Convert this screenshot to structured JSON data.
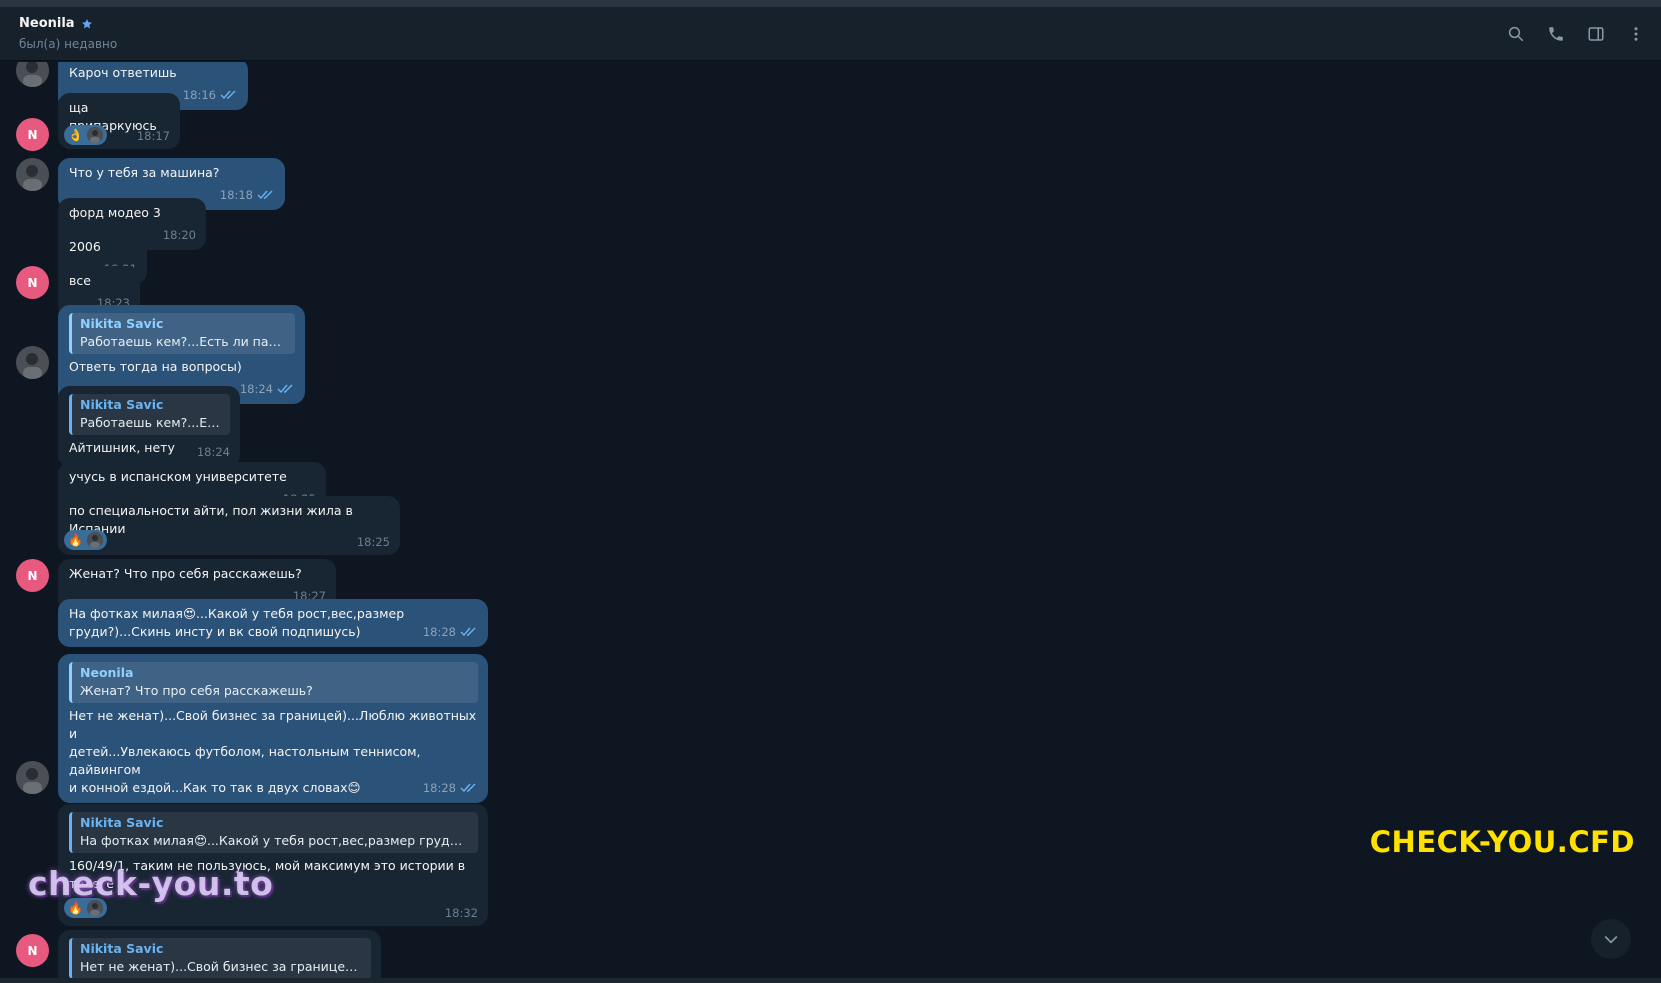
{
  "header": {
    "name": "Neonila",
    "status": "был(а) недавно",
    "icons": [
      "star-icon",
      "search-icon",
      "phone-icon",
      "sidebar-toggle-icon",
      "more-vertical-icon"
    ]
  },
  "avatar_initial": "N",
  "messages": [
    {
      "id": "m1",
      "text": "Кароч ответишь",
      "time": "18:16"
    },
    {
      "id": "m2",
      "text": "ща припаркуюсь",
      "time": "18:17",
      "reaction": "👌"
    },
    {
      "id": "m3",
      "text": "Что у тебя за машина?",
      "time": "18:18"
    },
    {
      "id": "m4",
      "text": "форд модео 3",
      "time": "18:20"
    },
    {
      "id": "m5",
      "text": "2006",
      "time": "18:21"
    },
    {
      "id": "m6",
      "text": "все",
      "time": "18:23"
    },
    {
      "id": "m7",
      "reply_name": "Nikita Savic",
      "reply_text": "Работаешь кем?...Есть ли парен...",
      "text": "Ответь тогда на вопросы)",
      "time": "18:24"
    },
    {
      "id": "m8",
      "reply_name": "Nikita Savic",
      "reply_text": "Работаешь кем?...Ест...",
      "text": "Айтишник, нету",
      "time": "18:24"
    },
    {
      "id": "m9",
      "text": "учусь в испанском университете",
      "time": "18:25"
    },
    {
      "id": "m10",
      "text": "по специальности айти, пол жизни жила в Испании",
      "time": "18:25",
      "reaction": "🔥"
    },
    {
      "id": "m11",
      "text": "Женат? Что про себя расскажешь?",
      "time": "18:27"
    },
    {
      "id": "m12",
      "text_line1": "На фотках милая😍...Какой у тебя рост,вес,размер",
      "text_line2": "груди?)...Скинь инсту и вк свой подпишусь)",
      "time": "18:28"
    },
    {
      "id": "m13",
      "reply_name": "Neonila",
      "reply_text": "Женат? Что про себя расскажешь?",
      "text_line1": "Нет не женат)...Свой бизнес за границей)...Люблю животных и",
      "text_line2": "детей...Увлекаюсь футболом, настольным теннисом, дайвингом",
      "text_line3": "и конной ездой...Как то так в двух словах😊",
      "time": "18:28"
    },
    {
      "id": "m14",
      "reply_name": "Nikita Savic",
      "reply_text": "На фотках милая😍...Какой у тебя рост,вес,размер груди?)......",
      "text_line1": "160/49/1, таким не пользуюсь, мой максимум это истории в",
      "text_line2": "телеге",
      "time": "18:32",
      "reaction": "🔥"
    },
    {
      "id": "m15",
      "reply_name": "Nikita Savic",
      "reply_text": "Нет не женат)...Свой бизнес за границей)...Л..."
    }
  ],
  "watermarks": {
    "right": "CHECK-YOU.CFD",
    "left": "check-you.to"
  },
  "colors": {
    "background": "#0e1621",
    "header": "#17212b",
    "outgoing_bubble": "#2b5278",
    "incoming_bubble": "#182533",
    "accent": "#6ab3f3",
    "avatar": "#e8597f",
    "watermark_right": "#ffe100"
  }
}
